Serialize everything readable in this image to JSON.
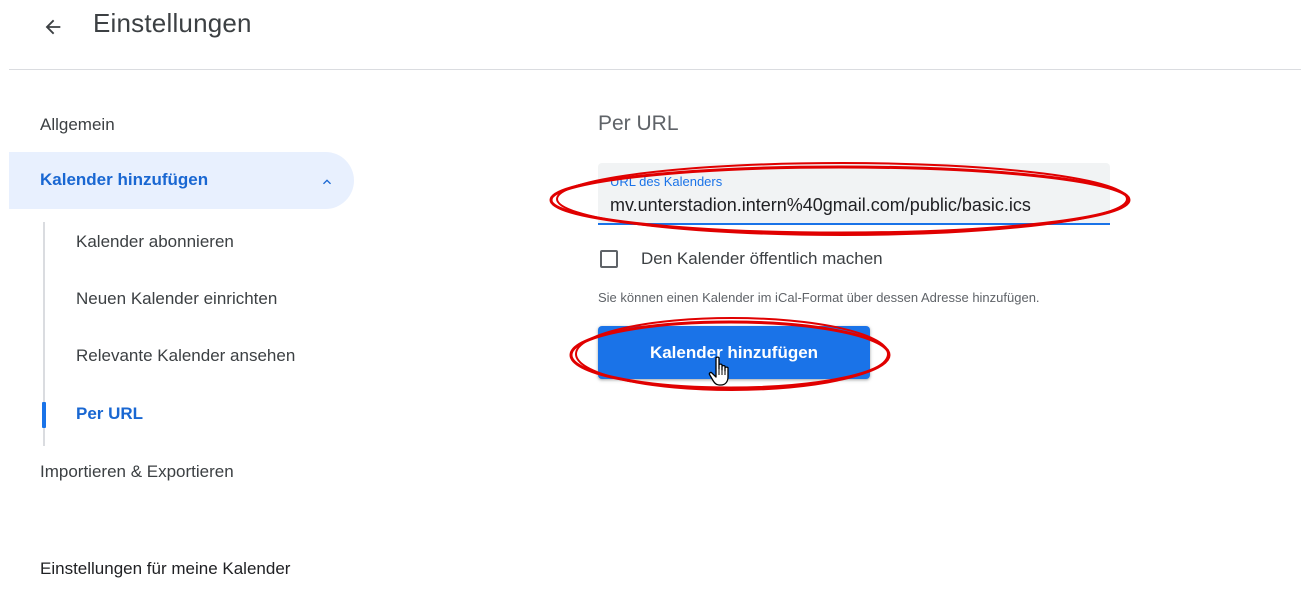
{
  "header": {
    "back_icon": "arrow-back-icon",
    "title": "Einstellungen"
  },
  "sidebar": {
    "items": [
      {
        "label": "Allgemein"
      },
      {
        "label": "Kalender hinzufügen",
        "expanded": true,
        "icon": "chevron-up-icon"
      },
      {
        "label": "Importieren & Exportieren"
      }
    ],
    "sub_items": [
      {
        "label": "Kalender abonnieren"
      },
      {
        "label": "Neuen Kalender einrichten"
      },
      {
        "label": "Relevante Kalender ansehen"
      },
      {
        "label": "Per URL",
        "active": true
      }
    ],
    "section_heading": "Einstellungen für meine Kalender"
  },
  "main": {
    "title": "Per URL",
    "url_field": {
      "label": "URL des Kalenders",
      "value": "mv.unterstadion.intern%40gmail.com/public/basic.ics"
    },
    "checkbox": {
      "label": "Den Kalender öffentlich machen",
      "checked": false
    },
    "helper_text": "Sie können einen Kalender im iCal-Format über dessen Adresse hinzufügen.",
    "submit_label": "Kalender hinzufügen"
  },
  "colors": {
    "accent": "#1a73e8",
    "active_bg": "#e8f0fe",
    "annotation": "#e00000"
  }
}
